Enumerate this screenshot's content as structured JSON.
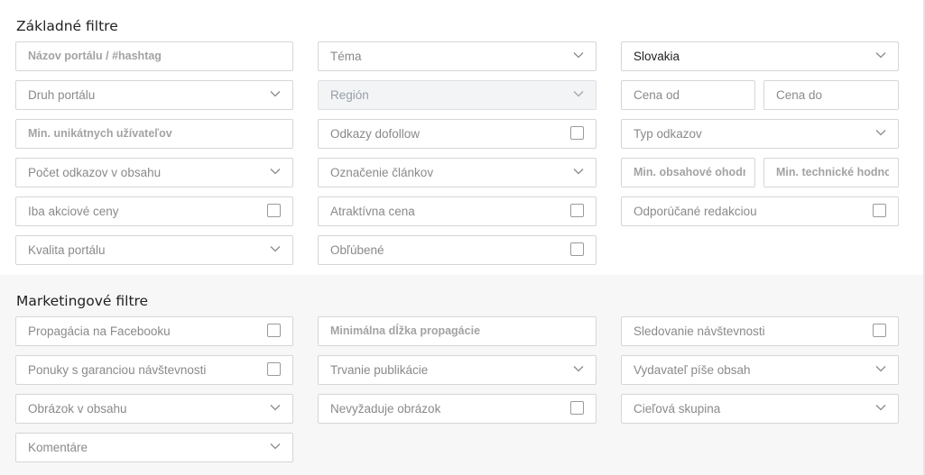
{
  "basic": {
    "title": "Základné filtre",
    "portal_name_placeholder": "Názov portálu / #hashtag",
    "topic_label": "Téma",
    "country_value": "Slovakia",
    "portal_type_label": "Druh portálu",
    "region_label": "Región",
    "price_from_placeholder": "Cena od",
    "price_to_placeholder": "Cena do",
    "min_unique_users_placeholder": "Min. unikátnych užívateľov",
    "dofollow_links_label": "Odkazy dofollow",
    "link_type_label": "Typ odkazov",
    "links_in_content_label": "Počet odkazov v obsahu",
    "article_marking_label": "Označenie článkov",
    "min_content_rating_placeholder": "Min. obsahové ohodnotenie",
    "min_technical_rating_placeholder": "Min. technické hodnotenie",
    "sale_prices_label": "Iba akciové ceny",
    "attractive_price_label": "Atraktívna cena",
    "recommended_label": "Odporúčané redakciou",
    "portal_quality_label": "Kvalita portálu",
    "favorites_label": "Obľúbené"
  },
  "marketing": {
    "title": "Marketingové filtre",
    "facebook_promo_label": "Propagácia na Facebooku",
    "min_promo_length_placeholder": "Minimálna dĺžka propagácie",
    "traffic_tracking_label": "Sledovanie návštevnosti",
    "guaranteed_traffic_label": "Ponuky s garanciou návštevnosti",
    "publication_duration_label": "Trvanie publikácie",
    "publisher_writes_label": "Vydavateľ píše obsah",
    "image_in_content_label": "Obrázok v obsahu",
    "no_image_required_label": "Nevyžaduje obrázok",
    "target_group_label": "Cieľová skupina",
    "comments_label": "Komentáre"
  },
  "colors": {
    "border": "#d6d6d6",
    "placeholder": "#8a8a8a",
    "marketing_bg": "#f7f7f7",
    "disabled_bg": "#f2f4f6"
  }
}
